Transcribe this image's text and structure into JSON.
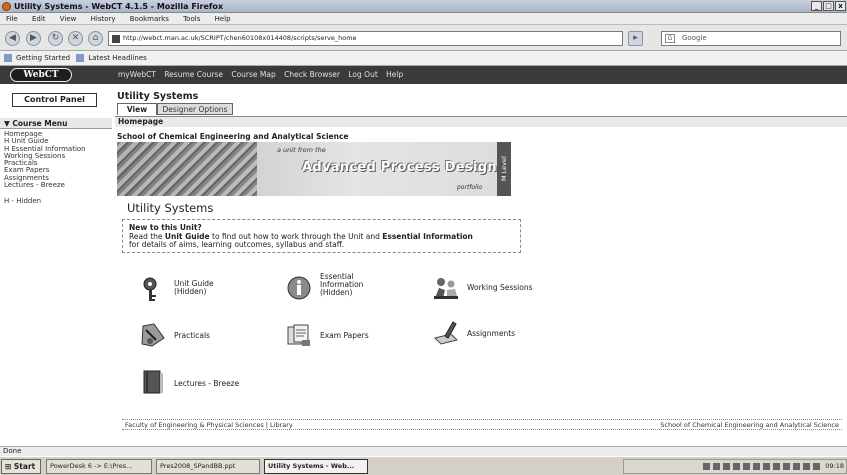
{
  "window": {
    "title": "Utility Systems - WebCT 4.1.5 - Mozilla Firefox",
    "controls": [
      "_",
      "□",
      "x"
    ]
  },
  "menubar": [
    "File",
    "Edit",
    "View",
    "History",
    "Bookmarks",
    "Tools",
    "Help"
  ],
  "navbar": {
    "url": "http://webct.man.ac.uk/SCRIPT/chen60108x014408/scripts/serve_home",
    "search_placeholder": "Google"
  },
  "bookmarks": [
    "Getting Started",
    "Latest Headlines"
  ],
  "webct": {
    "logo": "WebCT",
    "links": [
      "myWebCT",
      "Resume Course",
      "Course Map",
      "Check Browser",
      "Log Out",
      "Help"
    ]
  },
  "sidebar": {
    "control_panel": "Control Panel",
    "course_menu": "Course Menu",
    "items": [
      "Homepage",
      "H Unit Guide",
      "H Essential Information",
      "Working Sessions",
      "Practicals",
      "Exam Papers",
      "Assignments",
      "Lectures - Breeze"
    ],
    "hidden_note": "H - Hidden"
  },
  "page": {
    "title": "Utility Systems",
    "tabs": {
      "view": "View",
      "designer": "Designer Options"
    },
    "breadcrumb": "Homepage",
    "school": "School of Chemical Engineering and Analytical Science",
    "banner": {
      "subtitle": "a unit from the",
      "title": "Advanced Process Design",
      "portfolio": "portfolio",
      "level": "M Level"
    },
    "unit_title": "Utility Systems",
    "intro": {
      "heading": "New to this Unit?",
      "line1_pre": "Read the ",
      "line1_b1": "Unit Guide",
      "line1_mid": " to find out how to work through the Unit and ",
      "line1_b2": "Essential Information",
      "line2": "for details of aims, learning outcomes, syllabus and staff."
    },
    "items": {
      "unit_guide": [
        "Unit Guide",
        "(Hidden)"
      ],
      "essential": [
        "Essential",
        "Information",
        "(Hidden)"
      ],
      "working": "Working Sessions",
      "practicals": "Practicals",
      "exam": "Exam Papers",
      "assignments": "Assignments",
      "lectures": "Lectures - Breeze"
    },
    "footer": {
      "left": "Faculty of Engineering & Physical Sciences | Library",
      "right": "School of Chemical Engineering and Analytical Science"
    }
  },
  "status": "Done",
  "taskbar": {
    "start": "Start",
    "tasks": [
      "PowerDesk 6 -> E:\\Pres...",
      "Pres2008_SPandBB.ppt",
      "Utility Systems - Web..."
    ],
    "clock": "09:18"
  }
}
